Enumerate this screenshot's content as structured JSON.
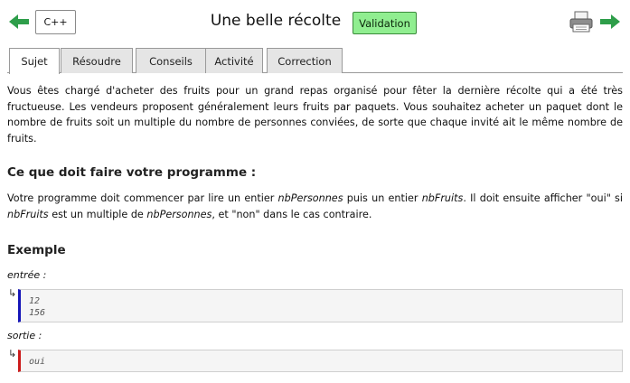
{
  "header": {
    "language_label": "C++",
    "title": "Une belle récolte",
    "validation_label": "Validation",
    "icons": {
      "back": "arrow-left-icon",
      "print": "printer-icon",
      "next": "arrow-right-icon"
    },
    "colors": {
      "arrow": "#2e9e4a",
      "validation_bg": "#90ee90"
    }
  },
  "tabs": [
    {
      "label": "Sujet",
      "active": true
    },
    {
      "label": "Résoudre",
      "active": false
    },
    {
      "label": "Conseils",
      "active": false
    },
    {
      "label": "Activité",
      "active": false
    },
    {
      "label": "Correction",
      "active": false
    }
  ],
  "statement": {
    "intro": "Vous êtes chargé d'acheter des fruits pour un grand repas organisé pour fêter la dernière récolte qui a été très fructueuse. Les vendeurs proposent généralement leurs fruits par paquets. Vous souhaitez acheter un paquet dont le nombre de fruits soit un multiple du nombre de personnes conviées, de sorte que chaque invité ait le même nombre de fruits.",
    "task_heading": "Ce que doit faire votre programme :",
    "task": {
      "t1": "Votre programme doit commencer par lire un entier ",
      "v1": "nbPersonnes",
      "t2": " puis un entier ",
      "v2": "nbFruits",
      "t3": ". Il doit ensuite afficher \"oui\" si ",
      "v3": "nbFruits",
      "t4": " est un multiple de ",
      "v4": "nbPersonnes",
      "t5": ", et \"non\" dans le cas contraire."
    },
    "example_heading": "Exemple",
    "input_label": "entrée :",
    "input_lines": [
      "12",
      "156"
    ],
    "output_label": "sortie :",
    "output_lines": [
      "oui"
    ],
    "arrow_glyph": "↳"
  }
}
